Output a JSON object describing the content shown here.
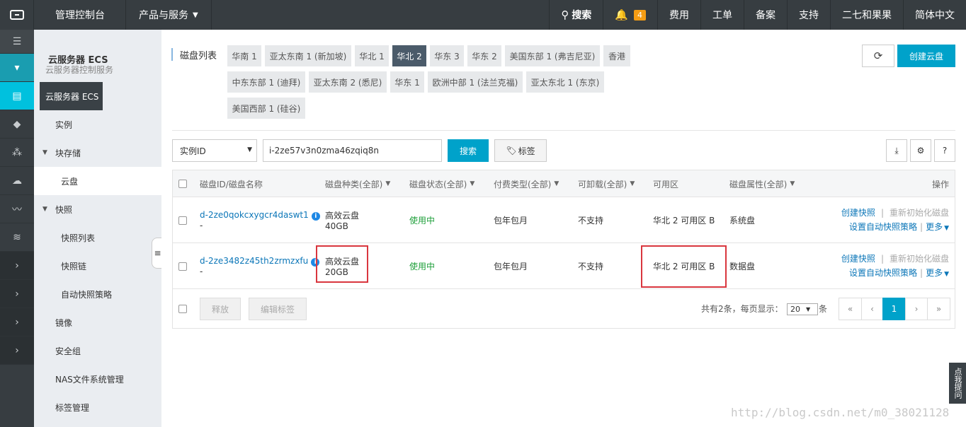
{
  "topbar": {
    "brand": "管理控制台",
    "products": "产品与服务",
    "search": "搜索",
    "notif_count": "4",
    "nav": [
      "费用",
      "工单",
      "备案",
      "支持",
      "二七和果果",
      "简体中文"
    ]
  },
  "sidebar": {
    "title": "云服务器 ECS",
    "tooltip": "云服务器 ECS",
    "ghost": "云服务器控制服务",
    "items": [
      {
        "label": "实例"
      },
      {
        "label": "块存储"
      },
      {
        "label": "云盘"
      },
      {
        "label": "快照"
      },
      {
        "label": "快照列表"
      },
      {
        "label": "快照链"
      },
      {
        "label": "自动快照策略"
      },
      {
        "label": "镜像"
      },
      {
        "label": "安全组"
      },
      {
        "label": "NAS文件系统管理"
      },
      {
        "label": "标签管理"
      }
    ]
  },
  "main": {
    "region_label": "磁盘列表",
    "regions": [
      "华南 1",
      "亚太东南 1 (新加坡)",
      "华北 1",
      "华北 2",
      "华东 3",
      "华东 2",
      "美国东部 1 (弗吉尼亚)",
      "香港",
      "中东东部 1 (迪拜)",
      "亚太东南 2 (悉尼)",
      "华东 1",
      "欧洲中部 1 (法兰克福)",
      "亚太东北 1 (东京)",
      "美国西部 1 (硅谷)"
    ],
    "active_region": "华北 2",
    "create_disk": "创建云盘",
    "search_select": "实例ID",
    "search_value": "i-2ze57v3n0zma46zqiq8n",
    "search_button": "搜索",
    "tag_button": "标签"
  },
  "table": {
    "headers": [
      "磁盘ID/磁盘名称",
      "磁盘种类(全部)",
      "磁盘状态(全部)",
      "付费类型(全部)",
      "可卸载(全部)",
      "可用区",
      "磁盘属性(全部)",
      "操作"
    ],
    "rows": [
      {
        "id": "d-2ze0qokcxygcr4daswt1",
        "name": "-",
        "type": "高效云盘",
        "size": "40GB",
        "status": "使用中",
        "billing": "包年包月",
        "detachable": "不支持",
        "zone": "华北 2 可用区 B",
        "attr": "系统盘",
        "op1": "创建快照",
        "op2": "重新初始化磁盘",
        "op3": "设置自动快照策略",
        "op4": "更多"
      },
      {
        "id": "d-2ze3482z45th2zrmzxfu",
        "name": "-",
        "type": "高效云盘",
        "size": "20GB",
        "status": "使用中",
        "billing": "包年包月",
        "detachable": "不支持",
        "zone": "华北 2 可用区 B",
        "attr": "数据盘",
        "op1": "创建快照",
        "op2": "重新初始化磁盘",
        "op3": "设置自动快照策略",
        "op4": "更多"
      }
    ],
    "release": "释放",
    "edit_tags": "编辑标签",
    "total_text": "共有2条，每页显示：",
    "page_size": "20",
    "page_size_unit": "条",
    "pager": [
      "«",
      "‹",
      "1",
      "›",
      "»"
    ]
  },
  "feedback": "点我提问",
  "watermark": "http://blog.csdn.net/m0_38021128"
}
